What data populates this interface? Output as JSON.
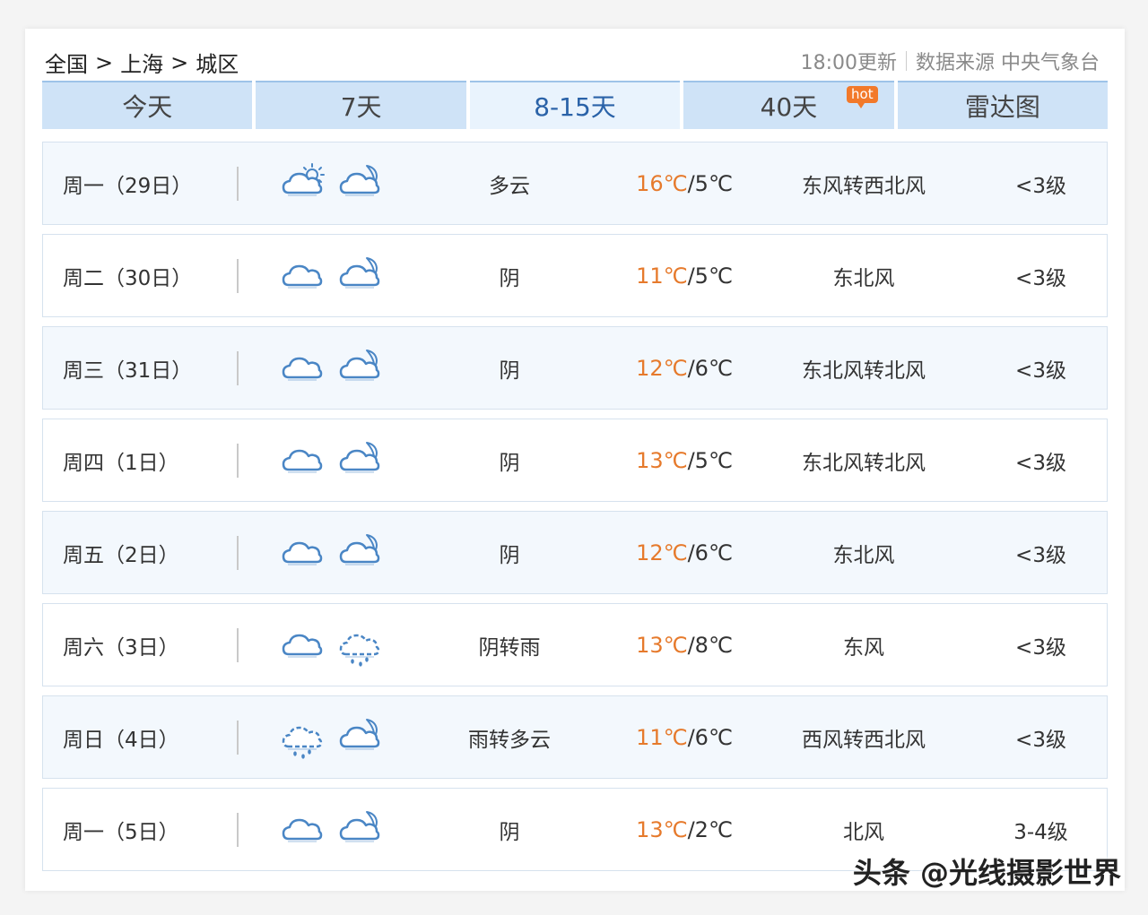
{
  "breadcrumb": [
    "全国",
    "上海",
    "城区"
  ],
  "breadcrumb_sep": ">",
  "meta": {
    "updated": "18:00更新",
    "source": "数据来源 中央气象台"
  },
  "tabs": [
    {
      "label": "今天"
    },
    {
      "label": "7天"
    },
    {
      "label": "8-15天",
      "active": true
    },
    {
      "label": "40天",
      "badge": "hot"
    },
    {
      "label": "雷达图"
    }
  ],
  "days": [
    {
      "day": "周一（29日）",
      "icon_day": "cloud-sun-icon",
      "icon_night": "cloud-moon-icon",
      "weather": "多云",
      "high": "16℃",
      "low": "5℃",
      "wind": "东风转西北风",
      "level": "<3级"
    },
    {
      "day": "周二（30日）",
      "icon_day": "overcast-icon",
      "icon_night": "cloud-moon-icon",
      "weather": "阴",
      "high": "11℃",
      "low": "5℃",
      "wind": "东北风",
      "level": "<3级"
    },
    {
      "day": "周三（31日）",
      "icon_day": "overcast-icon",
      "icon_night": "cloud-moon-icon",
      "weather": "阴",
      "high": "12℃",
      "low": "6℃",
      "wind": "东北风转北风",
      "level": "<3级"
    },
    {
      "day": "周四（1日）",
      "icon_day": "overcast-icon",
      "icon_night": "cloud-moon-icon",
      "weather": "阴",
      "high": "13℃",
      "low": "5℃",
      "wind": "东北风转北风",
      "level": "<3级"
    },
    {
      "day": "周五（2日）",
      "icon_day": "overcast-icon",
      "icon_night": "cloud-moon-icon",
      "weather": "阴",
      "high": "12℃",
      "low": "6℃",
      "wind": "东北风",
      "level": "<3级"
    },
    {
      "day": "周六（3日）",
      "icon_day": "overcast-icon",
      "icon_night": "rain-icon",
      "weather": "阴转雨",
      "high": "13℃",
      "low": "8℃",
      "wind": "东风",
      "level": "<3级"
    },
    {
      "day": "周日（4日）",
      "icon_day": "rain-icon",
      "icon_night": "cloud-moon-icon",
      "weather": "雨转多云",
      "high": "11℃",
      "low": "6℃",
      "wind": "西风转西北风",
      "level": "<3级"
    },
    {
      "day": "周一（5日）",
      "icon_day": "overcast-icon",
      "icon_night": "cloud-moon-icon",
      "weather": "阴",
      "high": "13℃",
      "low": "2℃",
      "wind": "北风",
      "level": "3-4级"
    }
  ],
  "watermark": "头条 @光线摄影世界",
  "colors": {
    "tab_bg": "#cfe3f7",
    "tab_active_text": "#2a62a8",
    "high_temp": "#e67a2c",
    "hot_badge": "#f2792a",
    "icon_stroke": "#4a86c5"
  }
}
